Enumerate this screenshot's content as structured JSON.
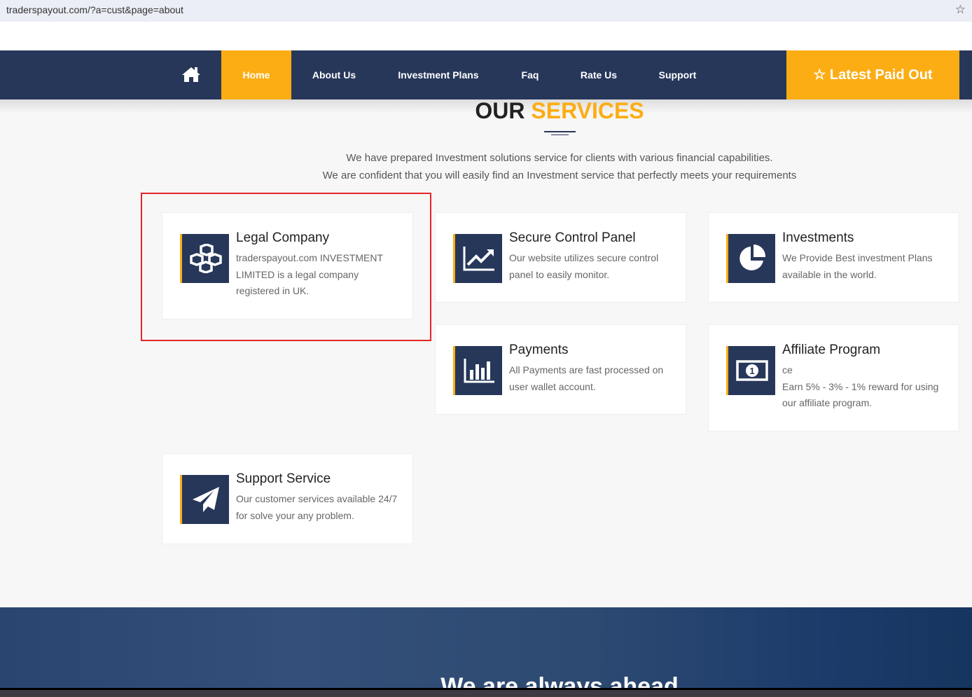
{
  "browser": {
    "url": "traderspayout.com/?a=cust&page=about"
  },
  "nav": {
    "items": [
      "Home",
      "About Us",
      "Investment Plans",
      "Faq",
      "Rate Us",
      "Support"
    ],
    "cta": "Latest Paid Out"
  },
  "section": {
    "title_a": "OUR",
    "title_b": "SERVICES",
    "intro1": "We have prepared Investment solutions service for clients with various financial capabilities.",
    "intro2": "We are confident that you will easily find an Investment service that perfectly meets your requirements"
  },
  "cards": [
    {
      "title": "Legal Company",
      "desc": "traderspayout.com INVESTMENT LIMITED is a legal company registered in UK.",
      "icon": "cubes-icon"
    },
    {
      "title": "Secure Control Panel",
      "desc": "Our website utilizes secure control panel to easily monitor.",
      "icon": "line-chart-icon"
    },
    {
      "title": "Investments",
      "desc": "We Provide Best investment Plans available in the world.",
      "icon": "pie-chart-icon"
    },
    {
      "title": "Payments",
      "desc": "All Payments are fast processed on user wallet account.",
      "icon": "bar-chart-icon"
    },
    {
      "title": "Affiliate Program",
      "desc": "ce\nEarn 5% - 3% - 1% reward for using our affiliate program.",
      "icon": "money-icon"
    },
    {
      "title": "Support Service",
      "desc": "Our customer services available 24/7 for solve your any problem.",
      "icon": "paper-plane-icon"
    }
  ],
  "banner": {
    "title": "We are always ahead"
  },
  "colors": {
    "navy": "#27375a",
    "accent": "#fcad14"
  }
}
